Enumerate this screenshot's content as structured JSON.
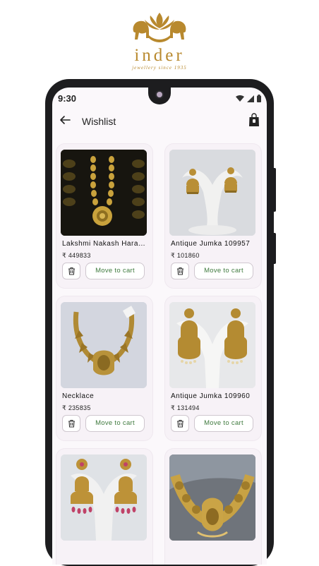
{
  "brand": {
    "name": "inder",
    "tagline": "jewellery since 1935"
  },
  "status_bar": {
    "time": "9:30"
  },
  "app_bar": {
    "title": "Wishlist"
  },
  "products": [
    {
      "name": "Lakshmi Nakash Haram 1",
      "price": "₹ 449833",
      "action": "Move to cart"
    },
    {
      "name": "Antique Jumka 109957",
      "price": "₹ 101860",
      "action": "Move to cart"
    },
    {
      "name": "Necklace",
      "price": "₹ 235835",
      "action": "Move to cart"
    },
    {
      "name": "Antique Jumka 109960",
      "price": "₹ 131494",
      "action": "Move to cart"
    },
    {
      "name": "",
      "price": "",
      "action": ""
    },
    {
      "name": "",
      "price": "",
      "action": ""
    }
  ],
  "colors": {
    "accent_green": "#3f7a3e",
    "brand_gold": "#b8892e",
    "screen_bg": "#fbf8fb"
  }
}
